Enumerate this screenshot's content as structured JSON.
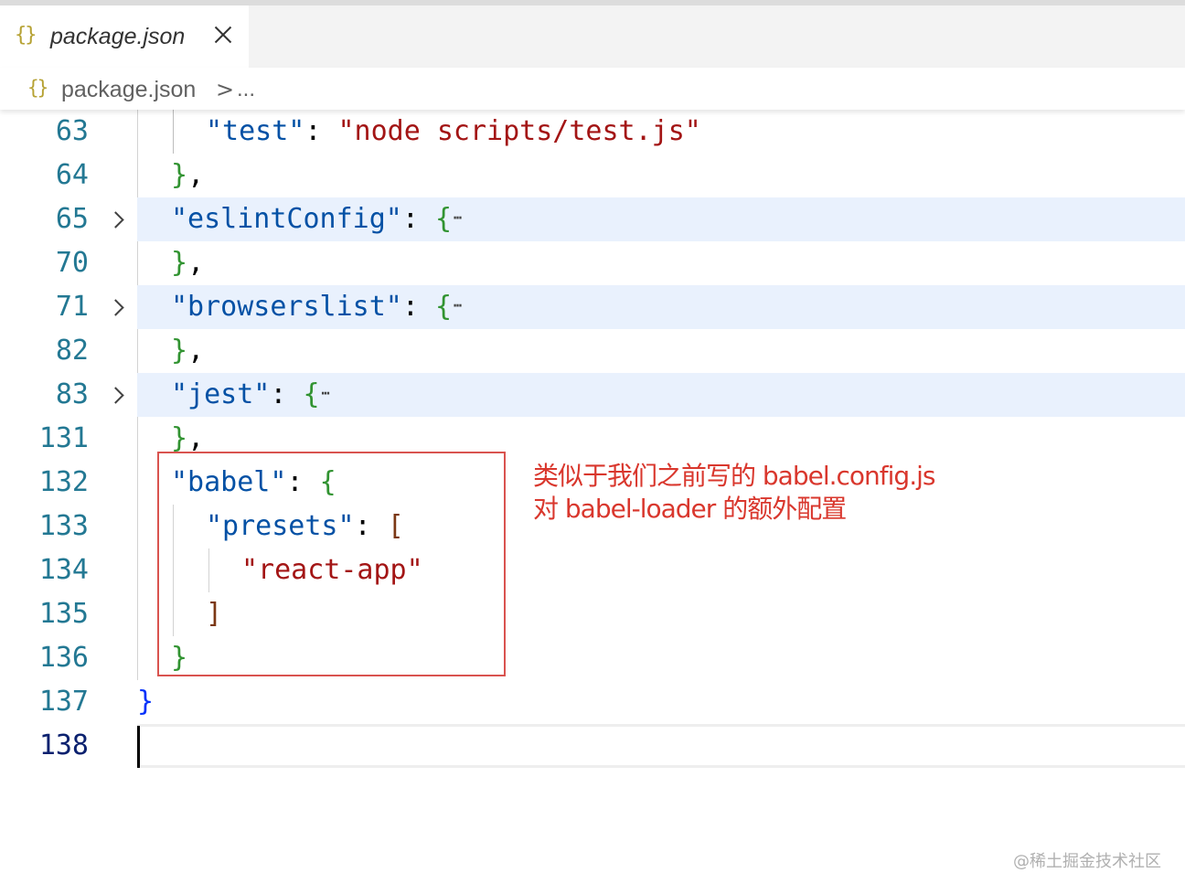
{
  "tab": {
    "icon": "{}",
    "title": "package.json",
    "close_icon": "close-icon"
  },
  "breadcrumb": {
    "icon": "{}",
    "file": "package.json",
    "separator": ">",
    "more": "..."
  },
  "lines": [
    {
      "n": "63"
    },
    {
      "n": "64"
    },
    {
      "n": "65"
    },
    {
      "n": "70"
    },
    {
      "n": "71"
    },
    {
      "n": "82"
    },
    {
      "n": "83"
    },
    {
      "n": "131"
    },
    {
      "n": "132"
    },
    {
      "n": "133"
    },
    {
      "n": "134"
    },
    {
      "n": "135"
    },
    {
      "n": "136"
    },
    {
      "n": "137"
    },
    {
      "n": "138"
    }
  ],
  "code": {
    "test_key": "\"test\"",
    "test_val": "\"node scripts/test.js\"",
    "eslint_key": "\"eslintConfig\"",
    "browserslist_key": "\"browserslist\"",
    "jest_key": "\"jest\"",
    "babel_key": "\"babel\"",
    "presets_key": "\"presets\"",
    "react_app_val": "\"react-app\"",
    "colon": ":",
    "open_brace": "{",
    "close_brace": "}",
    "close_brace_comma": "},",
    "open_bracket": "[",
    "close_bracket": "]"
  },
  "annotation": {
    "line1": "类似于我们之前写的 babel.config.js",
    "line2": "对 babel-loader 的额外配置"
  },
  "watermark": "@稀土掘金技术社区",
  "colors": {
    "key": "#0451a5",
    "string": "#a31515",
    "bracket_level1": "#319331",
    "bracket_level2": "#7b3814",
    "bracket_level0": "#0431fa",
    "line_number": "#237893",
    "folded_highlight": "#e9f1fd",
    "annotation": "#d9372d"
  }
}
